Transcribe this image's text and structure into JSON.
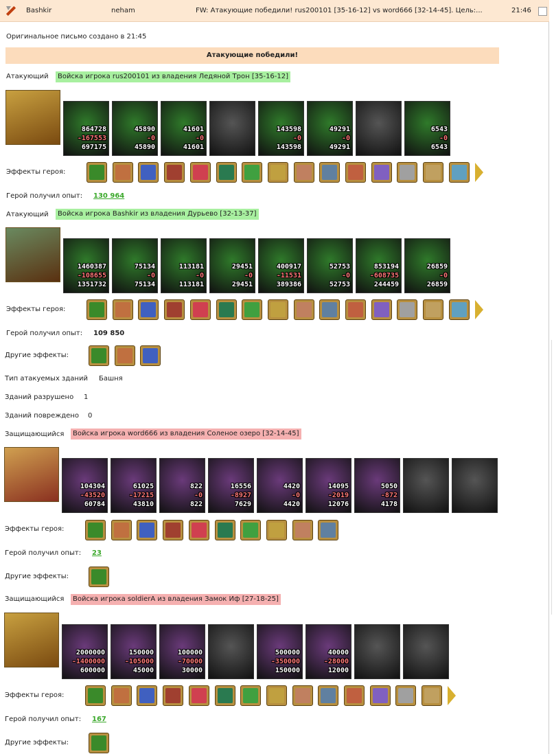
{
  "header": {
    "from": "Bashkir",
    "to": "neham",
    "subject": "FW: Атакующие победили! rus200101 [35-16-12] vs word666 [32-14-45]. Цель:...",
    "time": "21:46"
  },
  "orig_line": "Оригинальное письмо создано в 21:45",
  "banner": "Атакующие победили!",
  "labels": {
    "attacker": "Атакующий",
    "defender": "Защищающийся",
    "effects": "Эффекты героя:",
    "xp": "Герой получил опыт:",
    "other": "Другие эффекты:"
  },
  "a1": {
    "army": "Войска игрока rus200101 из владения Ледяной Трон [35-16-12]",
    "xp": "130 964"
  },
  "a2": {
    "army": "Войска игрока Bashkir из владения Дурьево [32-13-37]",
    "xp": "109 850"
  },
  "buildings": {
    "type_label": "Тип атакуемых зданий",
    "type_value": "Башня",
    "destroyed_label": "Зданий разрушено",
    "destroyed": "1",
    "damaged_label": "Зданий повреждено",
    "damaged": "0"
  },
  "d1": {
    "army": "Войска игрока word666 из владения Соленое озеро [32-14-45]",
    "xp": "23"
  },
  "d2": {
    "army": "Войска игрока soldierA из владения Замок Иф [27-18-25]",
    "xp": "167"
  },
  "units": {
    "a1": [
      [
        "864728",
        "-167553",
        "697175"
      ],
      [
        "45890",
        "-0",
        "45890"
      ],
      [
        "41601",
        "-0",
        "41601"
      ],
      [
        "",
        "",
        ""
      ],
      [
        "143598",
        "-0",
        "143598"
      ],
      [
        "49291",
        "-0",
        "49291"
      ],
      [
        "",
        "",
        ""
      ],
      [
        "6543",
        "-0",
        "6543"
      ]
    ],
    "a2": [
      [
        "1460387",
        "-108655",
        "1351732"
      ],
      [
        "75134",
        "-0",
        "75134"
      ],
      [
        "113181",
        "-0",
        "113181"
      ],
      [
        "29451",
        "-0",
        "29451"
      ],
      [
        "400917",
        "-11531",
        "389386"
      ],
      [
        "52753",
        "-0",
        "52753"
      ],
      [
        "853194",
        "-608735",
        "244459"
      ],
      [
        "26859",
        "-0",
        "26859"
      ]
    ],
    "d1": [
      [
        "104304",
        "-43520",
        "60784"
      ],
      [
        "61025",
        "-17215",
        "43810"
      ],
      [
        "822",
        "-0",
        "822"
      ],
      [
        "16556",
        "-8927",
        "7629"
      ],
      [
        "4420",
        "-0",
        "4420"
      ],
      [
        "14095",
        "-2019",
        "12076"
      ],
      [
        "5050",
        "-872",
        "4178"
      ],
      [
        "",
        "",
        ""
      ],
      [
        "",
        "",
        ""
      ]
    ],
    "d2": [
      [
        "2000000",
        "-1400000",
        "600000"
      ],
      [
        "150000",
        "-105000",
        "45000"
      ],
      [
        "100000",
        "-70000",
        "30000"
      ],
      [
        "",
        "",
        ""
      ],
      [
        "500000",
        "-350000",
        "150000"
      ],
      [
        "40000",
        "-28000",
        "12000"
      ],
      [
        "",
        "",
        ""
      ],
      [
        "",
        "",
        ""
      ]
    ]
  },
  "colors": {
    "a_unit": "#2f7a2a",
    "d_unit": "#6a3a7a",
    "grey_unit": "#555555",
    "attacker_bg": "#a8f0a0",
    "defender_bg": "#f5b0b0"
  }
}
